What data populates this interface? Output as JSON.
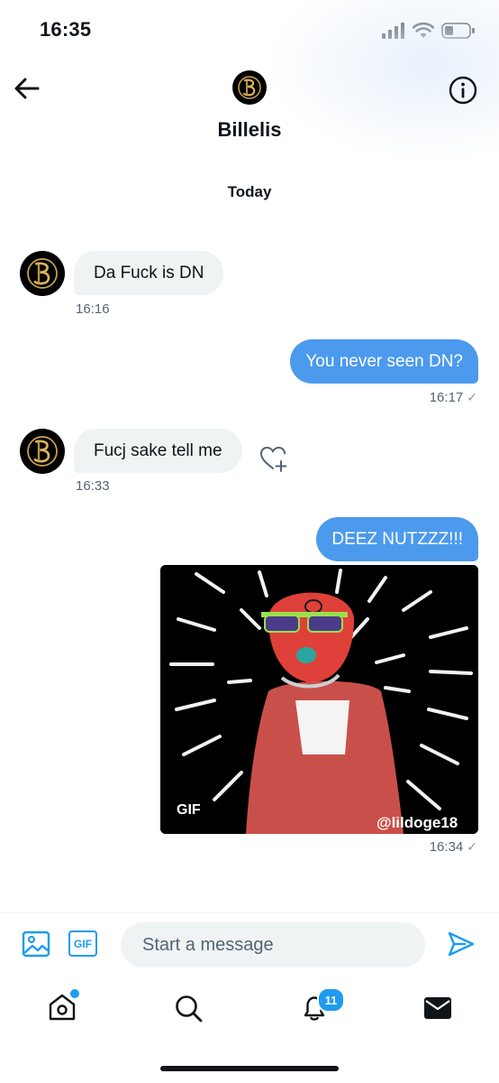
{
  "status_bar": {
    "time": "16:35"
  },
  "header": {
    "name": "Billelis",
    "day_label": "Today"
  },
  "messages": [
    {
      "direction": "in",
      "text": "Da Fuck is DN",
      "time": "16:16"
    },
    {
      "direction": "out",
      "text": "You never seen DN?",
      "time": "16:17"
    },
    {
      "direction": "in",
      "text": "Fucj sake tell me",
      "time": "16:33"
    },
    {
      "direction": "out",
      "text": "DEEZ NUTZZZ!!!",
      "time": ""
    },
    {
      "direction": "out",
      "type": "gif",
      "badge": "GIF",
      "watermark": "@lildoge18",
      "time": "16:34"
    }
  ],
  "composer": {
    "placeholder": "Start a message",
    "gif_label": "GIF"
  },
  "tab_bar": {
    "notifications_count": "11"
  },
  "colors": {
    "accent": "#1d9bf0",
    "out_bubble": "#4c9aed",
    "in_bubble": "#eff3f4"
  }
}
